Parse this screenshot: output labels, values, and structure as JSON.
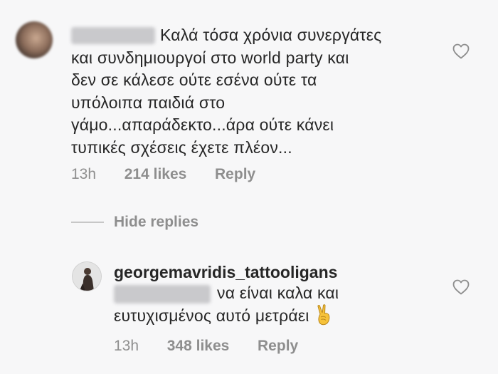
{
  "comments": [
    {
      "username_blurred": true,
      "text_lines": [
        "Καλά τόσα χρόνια συνεργάτες",
        "και συνδημιουργοί στο world party και",
        "δεν σε κάλεσε ούτε εσένα ούτε τα",
        "υπόλοιπα παιδιά στο",
        "γάμο...απαράδεκτο...άρα ούτε κάνει",
        "τυπικές σχέσεις έχετε πλέον..."
      ],
      "time": "13h",
      "likes": "214 likes",
      "reply_label": "Reply",
      "like_icon": "heart-outline-icon"
    }
  ],
  "hide_replies_label": "Hide replies",
  "reply": {
    "username": "georgemavridis_tattooligans",
    "mention_blurred": true,
    "text_lines": [
      "να είναι καλα και",
      "ευτυχισμένος αυτό μετράει"
    ],
    "emoji": "victory-hand-emoji",
    "time": "13h",
    "likes": "348 likes",
    "reply_label": "Reply",
    "like_icon": "heart-outline-icon"
  },
  "colors": {
    "background": "#f7f7f8",
    "text": "#262626",
    "secondary_text": "#8e8e8e"
  }
}
